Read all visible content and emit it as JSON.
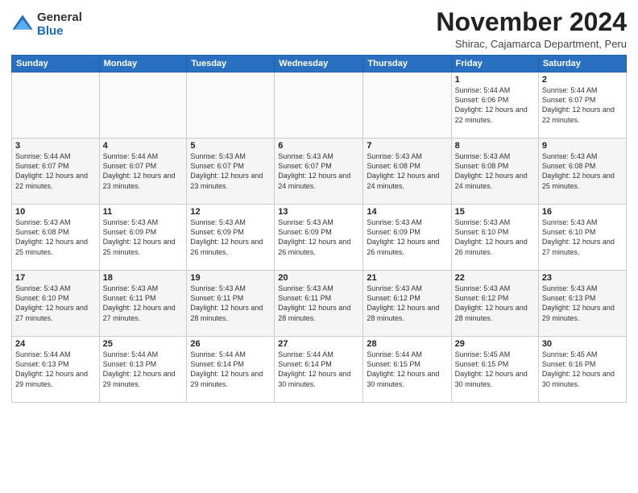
{
  "logo": {
    "general": "General",
    "blue": "Blue"
  },
  "title": "November 2024",
  "subtitle": "Shirac, Cajamarca Department, Peru",
  "days_of_week": [
    "Sunday",
    "Monday",
    "Tuesday",
    "Wednesday",
    "Thursday",
    "Friday",
    "Saturday"
  ],
  "weeks": [
    [
      {
        "day": "",
        "info": ""
      },
      {
        "day": "",
        "info": ""
      },
      {
        "day": "",
        "info": ""
      },
      {
        "day": "",
        "info": ""
      },
      {
        "day": "",
        "info": ""
      },
      {
        "day": "1",
        "info": "Sunrise: 5:44 AM\nSunset: 6:06 PM\nDaylight: 12 hours and 22 minutes."
      },
      {
        "day": "2",
        "info": "Sunrise: 5:44 AM\nSunset: 6:07 PM\nDaylight: 12 hours and 22 minutes."
      }
    ],
    [
      {
        "day": "3",
        "info": "Sunrise: 5:44 AM\nSunset: 6:07 PM\nDaylight: 12 hours and 22 minutes."
      },
      {
        "day": "4",
        "info": "Sunrise: 5:44 AM\nSunset: 6:07 PM\nDaylight: 12 hours and 23 minutes."
      },
      {
        "day": "5",
        "info": "Sunrise: 5:43 AM\nSunset: 6:07 PM\nDaylight: 12 hours and 23 minutes."
      },
      {
        "day": "6",
        "info": "Sunrise: 5:43 AM\nSunset: 6:07 PM\nDaylight: 12 hours and 24 minutes."
      },
      {
        "day": "7",
        "info": "Sunrise: 5:43 AM\nSunset: 6:08 PM\nDaylight: 12 hours and 24 minutes."
      },
      {
        "day": "8",
        "info": "Sunrise: 5:43 AM\nSunset: 6:08 PM\nDaylight: 12 hours and 24 minutes."
      },
      {
        "day": "9",
        "info": "Sunrise: 5:43 AM\nSunset: 6:08 PM\nDaylight: 12 hours and 25 minutes."
      }
    ],
    [
      {
        "day": "10",
        "info": "Sunrise: 5:43 AM\nSunset: 6:08 PM\nDaylight: 12 hours and 25 minutes."
      },
      {
        "day": "11",
        "info": "Sunrise: 5:43 AM\nSunset: 6:09 PM\nDaylight: 12 hours and 25 minutes."
      },
      {
        "day": "12",
        "info": "Sunrise: 5:43 AM\nSunset: 6:09 PM\nDaylight: 12 hours and 26 minutes."
      },
      {
        "day": "13",
        "info": "Sunrise: 5:43 AM\nSunset: 6:09 PM\nDaylight: 12 hours and 26 minutes."
      },
      {
        "day": "14",
        "info": "Sunrise: 5:43 AM\nSunset: 6:09 PM\nDaylight: 12 hours and 26 minutes."
      },
      {
        "day": "15",
        "info": "Sunrise: 5:43 AM\nSunset: 6:10 PM\nDaylight: 12 hours and 26 minutes."
      },
      {
        "day": "16",
        "info": "Sunrise: 5:43 AM\nSunset: 6:10 PM\nDaylight: 12 hours and 27 minutes."
      }
    ],
    [
      {
        "day": "17",
        "info": "Sunrise: 5:43 AM\nSunset: 6:10 PM\nDaylight: 12 hours and 27 minutes."
      },
      {
        "day": "18",
        "info": "Sunrise: 5:43 AM\nSunset: 6:11 PM\nDaylight: 12 hours and 27 minutes."
      },
      {
        "day": "19",
        "info": "Sunrise: 5:43 AM\nSunset: 6:11 PM\nDaylight: 12 hours and 28 minutes."
      },
      {
        "day": "20",
        "info": "Sunrise: 5:43 AM\nSunset: 6:11 PM\nDaylight: 12 hours and 28 minutes."
      },
      {
        "day": "21",
        "info": "Sunrise: 5:43 AM\nSunset: 6:12 PM\nDaylight: 12 hours and 28 minutes."
      },
      {
        "day": "22",
        "info": "Sunrise: 5:43 AM\nSunset: 6:12 PM\nDaylight: 12 hours and 28 minutes."
      },
      {
        "day": "23",
        "info": "Sunrise: 5:43 AM\nSunset: 6:13 PM\nDaylight: 12 hours and 29 minutes."
      }
    ],
    [
      {
        "day": "24",
        "info": "Sunrise: 5:44 AM\nSunset: 6:13 PM\nDaylight: 12 hours and 29 minutes."
      },
      {
        "day": "25",
        "info": "Sunrise: 5:44 AM\nSunset: 6:13 PM\nDaylight: 12 hours and 29 minutes."
      },
      {
        "day": "26",
        "info": "Sunrise: 5:44 AM\nSunset: 6:14 PM\nDaylight: 12 hours and 29 minutes."
      },
      {
        "day": "27",
        "info": "Sunrise: 5:44 AM\nSunset: 6:14 PM\nDaylight: 12 hours and 30 minutes."
      },
      {
        "day": "28",
        "info": "Sunrise: 5:44 AM\nSunset: 6:15 PM\nDaylight: 12 hours and 30 minutes."
      },
      {
        "day": "29",
        "info": "Sunrise: 5:45 AM\nSunset: 6:15 PM\nDaylight: 12 hours and 30 minutes."
      },
      {
        "day": "30",
        "info": "Sunrise: 5:45 AM\nSunset: 6:16 PM\nDaylight: 12 hours and 30 minutes."
      }
    ]
  ]
}
